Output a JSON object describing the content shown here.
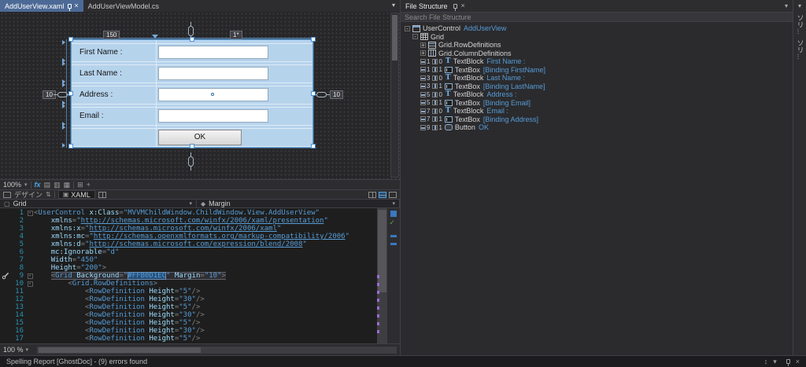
{
  "window": {
    "tabs": [
      {
        "label": "AddUserView.xaml",
        "active": true
      },
      {
        "label": "AddUserViewModel.cs",
        "active": false
      }
    ]
  },
  "designer": {
    "grid_adorners": {
      "col1_width": "150",
      "col2_width": "1*",
      "margin_left": "10",
      "margin_right": "10"
    },
    "form": {
      "rows": [
        {
          "label": "First Name :"
        },
        {
          "label": "Last Name :"
        },
        {
          "label": "Address :",
          "dot": true
        },
        {
          "label": "Email :"
        }
      ],
      "ok_button": "OK"
    },
    "toolbar": {
      "zoom": "100%",
      "fx": "fx"
    }
  },
  "view_bar": {
    "design_tab": "デザイン",
    "xaml_tab": "XAML"
  },
  "breadcrumb": {
    "element": "Grid",
    "property": "Margin"
  },
  "editor": {
    "zoom": "100 %",
    "lines": [
      {
        "n": 1,
        "fold": true,
        "tok": [
          [
            "<",
            "d"
          ],
          [
            "UserControl",
            "t"
          ],
          [
            " ",
            ""
          ],
          [
            "x:Class",
            "a"
          ],
          [
            "=",
            "d"
          ],
          [
            "\"MVVMChildWindow.ChildWindow.View.AddUserView\"",
            "v"
          ]
        ]
      },
      {
        "n": 2,
        "tok": [
          [
            "    ",
            ""
          ],
          [
            "xmlns",
            "a"
          ],
          [
            "=",
            "d"
          ],
          [
            "\"",
            "v"
          ],
          [
            "http://schemas.microsoft.com/winfx/2006/xaml/presentation",
            "u"
          ],
          [
            "\"",
            "v"
          ]
        ]
      },
      {
        "n": 3,
        "tok": [
          [
            "    ",
            ""
          ],
          [
            "xmlns:x",
            "a"
          ],
          [
            "=",
            "d"
          ],
          [
            "\"",
            "v"
          ],
          [
            "http://schemas.microsoft.com/winfx/2006/xaml",
            "u"
          ],
          [
            "\"",
            "v"
          ]
        ]
      },
      {
        "n": 4,
        "tok": [
          [
            "    ",
            ""
          ],
          [
            "xmlns:mc",
            "a"
          ],
          [
            "=",
            "d"
          ],
          [
            "\"",
            "v"
          ],
          [
            "http://schemas.openxmlformats.org/markup-compatibility/2006",
            "u"
          ],
          [
            "\"",
            "v"
          ]
        ]
      },
      {
        "n": 5,
        "tok": [
          [
            "    ",
            ""
          ],
          [
            "xmlns:d",
            "a"
          ],
          [
            "=",
            "d"
          ],
          [
            "\"",
            "v"
          ],
          [
            "http://schemas.microsoft.com/expression/blend/2008",
            "u"
          ],
          [
            "\"",
            "v"
          ]
        ]
      },
      {
        "n": 6,
        "tok": [
          [
            "    ",
            ""
          ],
          [
            "mc:Ignorable",
            "a"
          ],
          [
            "=",
            "d"
          ],
          [
            "\"d\"",
            "v"
          ]
        ]
      },
      {
        "n": 7,
        "tok": [
          [
            "    ",
            ""
          ],
          [
            "Width",
            "a"
          ],
          [
            "=",
            "d"
          ],
          [
            "\"450\"",
            "v"
          ]
        ]
      },
      {
        "n": 8,
        "tok": [
          [
            "    ",
            ""
          ],
          [
            "Height",
            "a"
          ],
          [
            "=",
            "d"
          ],
          [
            "\"200\"",
            "v"
          ],
          [
            ">",
            "d"
          ]
        ]
      },
      {
        "n": 9,
        "fold": true,
        "wrench": true,
        "tok": [
          [
            "    ",
            ""
          ],
          [
            "<",
            "d hl"
          ],
          [
            "Grid",
            "t hl"
          ],
          [
            " ",
            "hl"
          ],
          [
            "Background",
            "a hl"
          ],
          [
            "=",
            "d hl"
          ],
          [
            "\"",
            "v hl"
          ],
          [
            "#FFB0D1EC",
            "v sel"
          ],
          [
            "\"",
            "v hl"
          ],
          [
            " ",
            "hl"
          ],
          [
            "Margin",
            "a hl"
          ],
          [
            "=",
            "d hl"
          ],
          [
            "\"10\"",
            "v hl"
          ],
          [
            ">",
            "d hl"
          ]
        ]
      },
      {
        "n": 10,
        "fold": true,
        "tok": [
          [
            "        ",
            ""
          ],
          [
            "<",
            "d"
          ],
          [
            "Grid.RowDefinitions",
            "t"
          ],
          [
            ">",
            "d"
          ]
        ]
      },
      {
        "n": 11,
        "tok": [
          [
            "            ",
            ""
          ],
          [
            "<",
            "d"
          ],
          [
            "RowDefinition",
            "t"
          ],
          [
            " ",
            ""
          ],
          [
            "Height",
            "a"
          ],
          [
            "=",
            "d"
          ],
          [
            "\"5\"",
            "v"
          ],
          [
            "/>",
            "d"
          ]
        ]
      },
      {
        "n": 12,
        "tok": [
          [
            "            ",
            ""
          ],
          [
            "<",
            "d"
          ],
          [
            "RowDefinition",
            "t"
          ],
          [
            " ",
            ""
          ],
          [
            "Height",
            "a"
          ],
          [
            "=",
            "d"
          ],
          [
            "\"30\"",
            "v"
          ],
          [
            "/>",
            "d"
          ]
        ]
      },
      {
        "n": 13,
        "tok": [
          [
            "            ",
            ""
          ],
          [
            "<",
            "d"
          ],
          [
            "RowDefinition",
            "t"
          ],
          [
            " ",
            ""
          ],
          [
            "Height",
            "a"
          ],
          [
            "=",
            "d"
          ],
          [
            "\"5\"",
            "v"
          ],
          [
            "/>",
            "d"
          ]
        ]
      },
      {
        "n": 14,
        "tok": [
          [
            "            ",
            ""
          ],
          [
            "<",
            "d"
          ],
          [
            "RowDefinition",
            "t"
          ],
          [
            " ",
            ""
          ],
          [
            "Height",
            "a"
          ],
          [
            "=",
            "d"
          ],
          [
            "\"30\"",
            "v"
          ],
          [
            "/>",
            "d"
          ]
        ]
      },
      {
        "n": 15,
        "tok": [
          [
            "            ",
            ""
          ],
          [
            "<",
            "d"
          ],
          [
            "RowDefinition",
            "t"
          ],
          [
            " ",
            ""
          ],
          [
            "Height",
            "a"
          ],
          [
            "=",
            "d"
          ],
          [
            "\"5\"",
            "v"
          ],
          [
            "/>",
            "d"
          ]
        ]
      },
      {
        "n": 16,
        "tok": [
          [
            "            ",
            ""
          ],
          [
            "<",
            "d"
          ],
          [
            "RowDefinition",
            "t"
          ],
          [
            " ",
            ""
          ],
          [
            "Height",
            "a"
          ],
          [
            "=",
            "d"
          ],
          [
            "\"30\"",
            "v"
          ],
          [
            "/>",
            "d"
          ]
        ]
      },
      {
        "n": 17,
        "tok": [
          [
            "            ",
            ""
          ],
          [
            "<",
            "d"
          ],
          [
            "RowDefinition",
            "t"
          ],
          [
            " ",
            ""
          ],
          [
            "Height",
            "a"
          ],
          [
            "=",
            "d"
          ],
          [
            "\"5\"",
            "v"
          ],
          [
            "/>",
            "d"
          ]
        ]
      }
    ]
  },
  "file_structure": {
    "title": "File Structure",
    "search_placeholder": "Search File Structure",
    "items": [
      {
        "indent": 0,
        "exp": "-",
        "icon": "usercontrol",
        "type": "UserControl",
        "value": "AddUserView"
      },
      {
        "indent": 1,
        "exp": "-",
        "icon": "grid",
        "type": "Grid",
        "value": ""
      },
      {
        "indent": 2,
        "exp": "+",
        "icon": "rowdefs",
        "type": "Grid.RowDefinitions",
        "value": ""
      },
      {
        "indent": 2,
        "exp": "+",
        "icon": "coldefs",
        "type": "Grid.ColumnDefinitions",
        "value": ""
      },
      {
        "indent": 2,
        "row": "1",
        "col": "0",
        "icon": "textblock",
        "type": "TextBlock",
        "value": "First Name :"
      },
      {
        "indent": 2,
        "row": "1",
        "col": "1",
        "icon": "textbox",
        "type": "TextBox",
        "value": "[Binding FirstName]"
      },
      {
        "indent": 2,
        "row": "3",
        "col": "0",
        "icon": "textblock",
        "type": "TextBlock",
        "value": "Last Name :"
      },
      {
        "indent": 2,
        "row": "3",
        "col": "1",
        "icon": "textbox",
        "type": "TextBox",
        "value": "[Binding LastName]"
      },
      {
        "indent": 2,
        "row": "5",
        "col": "0",
        "icon": "textblock",
        "type": "TextBlock",
        "value": "Address :"
      },
      {
        "indent": 2,
        "row": "5",
        "col": "1",
        "icon": "textbox",
        "type": "TextBox",
        "value": "[Binding Email]"
      },
      {
        "indent": 2,
        "row": "7",
        "col": "0",
        "icon": "textblock",
        "type": "TextBlock",
        "value": "Email :"
      },
      {
        "indent": 2,
        "row": "7",
        "col": "1",
        "icon": "textbox",
        "type": "TextBox",
        "value": "[Binding Address]"
      },
      {
        "indent": 2,
        "row": "9",
        "col": "1",
        "icon": "button",
        "type": "Button",
        "value": "OK"
      }
    ]
  },
  "side_strip": {
    "tabs": [
      "ソリ...",
      "ソリ..."
    ]
  },
  "status_bar": {
    "message": "Spelling Report [GhostDoc] - (9) errors found"
  }
}
